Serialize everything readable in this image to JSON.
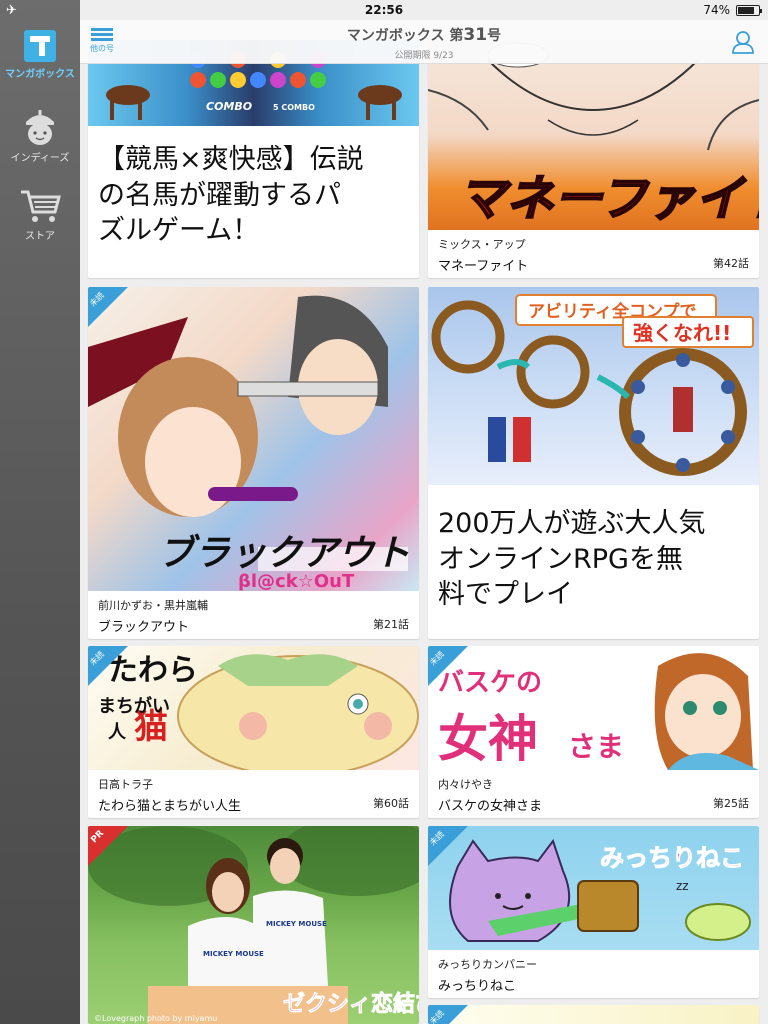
{
  "status": {
    "time": "22:56",
    "battery": "74%",
    "battery_level": 0.74
  },
  "sidebar": {
    "items": [
      {
        "label": "マンガボックス",
        "icon": "mangabox-logo-icon"
      },
      {
        "label": "インディーズ",
        "icon": "acorn-icon"
      },
      {
        "label": "ストア",
        "icon": "cart-icon"
      }
    ]
  },
  "header": {
    "menu_label": "他の号",
    "title_prefix": "マンガボックス 第",
    "issue_number": "31",
    "title_suffix": "号",
    "subtitle": "公開期限 9/23"
  },
  "cards": {
    "horse_ad": {
      "text": "【競馬×爽快感】伝説の名馬が躍動するパズルゲーム！",
      "line1": "【競馬×爽快感】伝説",
      "line2": "の名馬が躍動するパ",
      "line3": "ズルゲーム！",
      "combo": "COMBO",
      "five_combo": "5 COMBO"
    },
    "money_fight": {
      "author": "ミックス・アップ",
      "title": "マネーファイト",
      "episode": "第42話",
      "art_title": "マネーファイト"
    },
    "blackout": {
      "badge": "未読",
      "author": "前川かずお・黒井嵐輔",
      "title": "ブラックアウト",
      "episode": "第21話",
      "art_title": "ブラックアウト",
      "art_subtitle": "βl@ck☆OuT"
    },
    "rpg_ad": {
      "banner1": "アビリティ全コンプで",
      "banner2": "強くなれ!!",
      "line1": "200万人が遊ぶ大人気",
      "line2": "オンラインRPGを無",
      "line3": "料でプレイ"
    },
    "tawara": {
      "badge": "未読",
      "author": "日高トラ子",
      "title": "たわら猫とまちがい人生",
      "episode": "第60話",
      "art_title1": "たわら",
      "art_title2": "猫",
      "art_sub1": "まちがい",
      "art_sub2": "人"
    },
    "basuke": {
      "badge": "未読",
      "author": "内々けやき",
      "title": "バスケの女神さま",
      "episode": "第25話",
      "art_small": "バスケの",
      "art_big": "女神",
      "art_tail": "さま"
    },
    "pr": {
      "badge": "PR",
      "art_title": "ゼクシィ恋結び",
      "credit": "©Lovegraph photo by miyamu",
      "shirt": "MICKEY MOUSE"
    },
    "mitchiri": {
      "badge": "未読",
      "author": "みっちりカンパニー",
      "title": "みっちりねこ",
      "art_title": "みっちりねこ",
      "zz": "zz"
    },
    "next": {
      "badge": "未読"
    }
  },
  "colors": {
    "accent": "#3a9fd8",
    "sidebar": "#5a5a5a",
    "unread_badge": "#3a9fd8",
    "pr_badge": "#d9302f"
  }
}
